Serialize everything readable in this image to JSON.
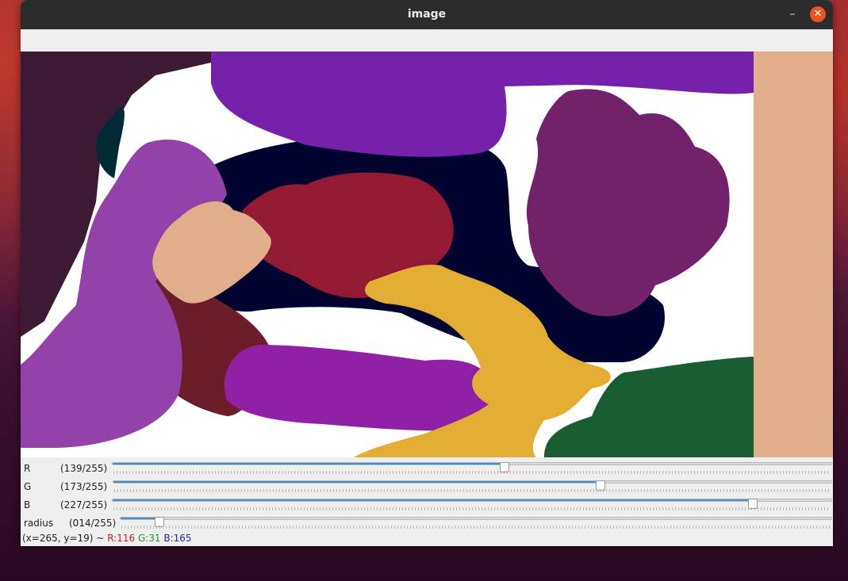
{
  "window": {
    "title": "image",
    "minimize_glyph": "–",
    "close_glyph": "✕",
    "close_color": "#e95420"
  },
  "trackbars": [
    {
      "name": "R",
      "value_text": "(139/255)",
      "value": 139,
      "max": 255
    },
    {
      "name": "G",
      "value_text": "(173/255)",
      "value": 173,
      "max": 255
    },
    {
      "name": "B",
      "value_text": "(227/255)",
      "value": 227,
      "max": 255
    },
    {
      "name": "radius",
      "value_text": "(014/255)",
      "value": 14,
      "max": 255
    }
  ],
  "status": {
    "coords": "(x=265, y=19) ~",
    "r": "R:116",
    "g": "G:31",
    "b": "B:165"
  },
  "colors": {
    "accent": "#3d8fd6",
    "swatch": "#e2ad8b"
  }
}
